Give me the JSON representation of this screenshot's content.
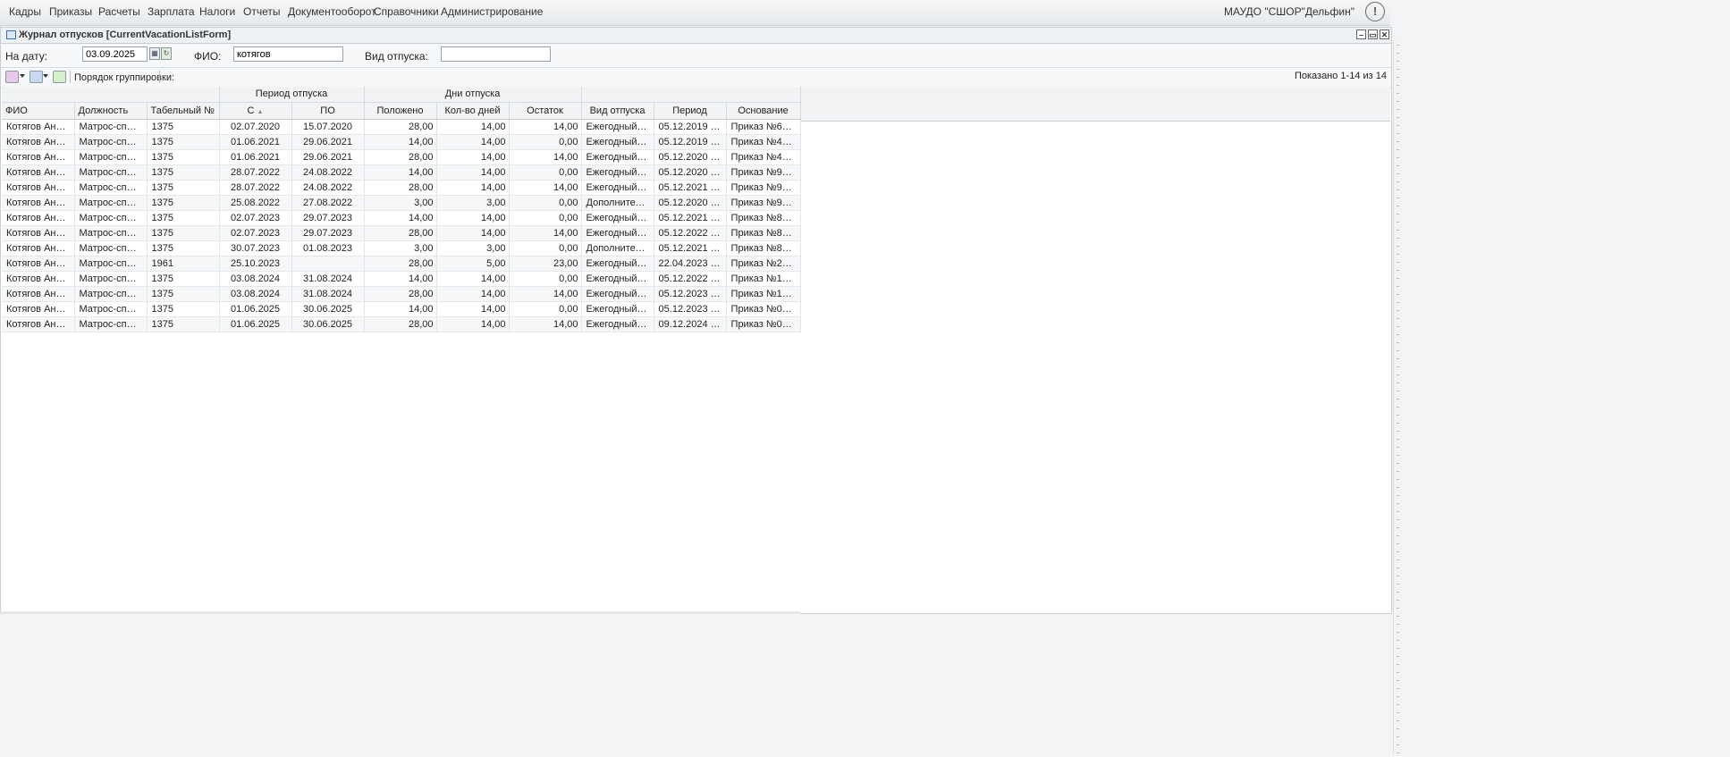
{
  "menu": {
    "items": [
      "Кадры",
      "Приказы",
      "Расчеты",
      "Зарплата",
      "Налоги",
      "Отчеты",
      "Документооборот",
      "Справочники",
      "Администрирование"
    ],
    "org": "МАУДО \"СШОР\"Дельфин\"",
    "alert_icon": "!"
  },
  "window": {
    "title": "Журнал отпусков [CurrentVacationListForm]",
    "buttons": [
      "–",
      "▭",
      "✕"
    ]
  },
  "filters": {
    "date_label": "На дату:",
    "date_value": "03.09.2025",
    "fio_label": "ФИО:",
    "fio_value": "котягов",
    "vid_label": "Вид отпуска:",
    "vid_value": ""
  },
  "toolbar": {
    "group_label": "Порядок группировки:",
    "shown": "Показано 1-14 из 14"
  },
  "table": {
    "group_headers": {
      "period": "Период отпуска",
      "days": "Дни отпуска"
    },
    "columns": [
      "ФИО",
      "Должность",
      "Табельный №",
      "С",
      "ПО",
      "Положено",
      "Кол-во дней",
      "Остаток",
      "Вид отпуска",
      "Период",
      "Основание"
    ],
    "sort_indicator": "▲",
    "rows": [
      [
        "Котягов Анатол...",
        "Матрос-спасате...",
        "1375",
        "02.07.2020",
        "15.07.2020",
        "28,00",
        "14,00",
        "14,00",
        "Ежегодный отп...",
        "05.12.2019 - 04....",
        "Приказ №65/о ..."
      ],
      [
        "Котягов Анатол...",
        "Матрос-спасате...",
        "1375",
        "01.06.2021",
        "29.06.2021",
        "14,00",
        "14,00",
        "0,00",
        "Ежегодный отп...",
        "05.12.2019 - 04....",
        "Приказ №45/о ..."
      ],
      [
        "Котягов Анатол...",
        "Матрос-спасате...",
        "1375",
        "01.06.2021",
        "29.06.2021",
        "28,00",
        "14,00",
        "14,00",
        "Ежегодный отп...",
        "05.12.2020 - 04....",
        "Приказ №45/о ..."
      ],
      [
        "Котягов Анатол...",
        "Матрос-спасате...",
        "1375",
        "28.07.2022",
        "24.08.2022",
        "14,00",
        "14,00",
        "0,00",
        "Ежегодный отп...",
        "05.12.2020 - 04....",
        "Приказ №97/о ..."
      ],
      [
        "Котягов Анатол...",
        "Матрос-спасате...",
        "1375",
        "28.07.2022",
        "24.08.2022",
        "28,00",
        "14,00",
        "14,00",
        "Ежегодный отп...",
        "05.12.2021 - 04....",
        "Приказ №97/о ..."
      ],
      [
        "Котягов Анатол...",
        "Матрос-спасате...",
        "1375",
        "25.08.2022",
        "27.08.2022",
        "3,00",
        "3,00",
        "0,00",
        "Дополнительны...",
        "05.12.2020 - 04....",
        "Приказ №97/о ..."
      ],
      [
        "Котягов Анатол...",
        "Матрос-спасате...",
        "1375",
        "02.07.2023",
        "29.07.2023",
        "14,00",
        "14,00",
        "0,00",
        "Ежегодный отп...",
        "05.12.2021 - 04....",
        "Приказ №86/о ..."
      ],
      [
        "Котягов Анатол...",
        "Матрос-спасате...",
        "1375",
        "02.07.2023",
        "29.07.2023",
        "28,00",
        "14,00",
        "14,00",
        "Ежегодный отп...",
        "05.12.2022 - 04....",
        "Приказ №86/о ..."
      ],
      [
        "Котягов Анатол...",
        "Матрос-спасате...",
        "1375",
        "30.07.2023",
        "01.08.2023",
        "3,00",
        "3,00",
        "0,00",
        "Дополнительны...",
        "05.12.2021 - 04....",
        "Приказ №86/о ..."
      ],
      [
        "Котягов Анатол...",
        "Матрос-спасате...",
        "1961",
        "25.10.2023",
        "",
        "28,00",
        "5,00",
        "23,00",
        "Ежегодный отп...",
        "22.04.2023 - 25....",
        "Приказ №218/л..."
      ],
      [
        "Котягов Анатол...",
        "Матрос-спасате...",
        "1375",
        "03.08.2024",
        "31.08.2024",
        "14,00",
        "14,00",
        "0,00",
        "Ежегодный отп...",
        "05.12.2022 - 04....",
        "Приказ №164/о..."
      ],
      [
        "Котягов Анатол...",
        "Матрос-спасате...",
        "1375",
        "03.08.2024",
        "31.08.2024",
        "28,00",
        "14,00",
        "14,00",
        "Ежегодный отп...",
        "05.12.2023 - 08....",
        "Приказ №164/о..."
      ],
      [
        "Котягов Анатол...",
        "Матрос-спасате...",
        "1375",
        "01.06.2025",
        "30.06.2025",
        "14,00",
        "14,00",
        "0,00",
        "Ежегодный отп...",
        "05.12.2023 - 08....",
        "Приказ №036/о..."
      ],
      [
        "Котягов Анатол...",
        "Матрос-спасате...",
        "1375",
        "01.06.2025",
        "30.06.2025",
        "28,00",
        "14,00",
        "14,00",
        "Ежегодный отп...",
        "09.12.2024 - 29....",
        "Приказ №036/о..."
      ]
    ]
  },
  "colors": {
    "accent": "#3a6ea5",
    "header_bg": "#f1f3f5",
    "border": "#c9ced3"
  }
}
